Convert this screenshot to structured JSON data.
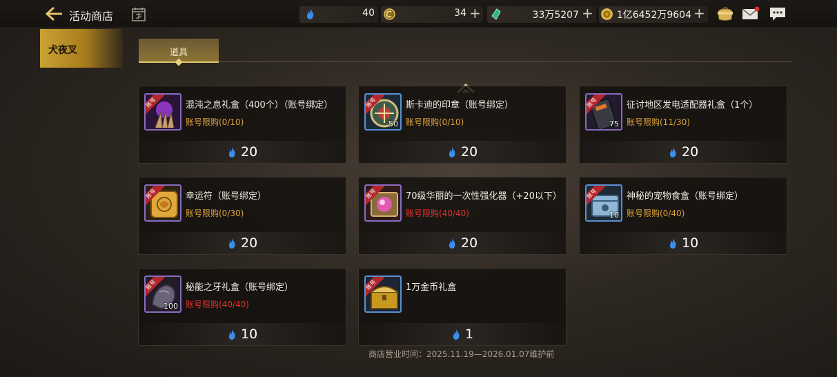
{
  "header": {
    "title": "活动商店",
    "back_icon": "back-arrow-icon",
    "calendar_icon": "calendar-icon"
  },
  "currencies": [
    {
      "icon": "blue-flame-icon",
      "value": "40",
      "has_plus": false
    },
    {
      "icon": "gold-coin-c-icon",
      "value": "34",
      "has_plus": true
    },
    {
      "icon": "green-crystal-icon",
      "value": "33万5207",
      "has_plus": true
    },
    {
      "icon": "gold-coin-icon",
      "value": "1亿6452万9604",
      "has_plus": true
    }
  ],
  "top_icons": [
    "bag-icon",
    "mail-icon",
    "chat-icon"
  ],
  "sidebar": {
    "selected_tab": "犬夜叉"
  },
  "subtabs": [
    {
      "label": "道具",
      "active": true
    }
  ],
  "items": [
    {
      "name": "混沌之息礼盒（400个）（账号绑定）",
      "limit": "账号限购(0/10)",
      "maxed": false,
      "price": "20",
      "qty": "",
      "bound": true,
      "icon": "chaos-claw-icon",
      "frame": "purple"
    },
    {
      "name": "斯卡迪的印章（账号绑定）",
      "limit": "账号限购(0/10)",
      "maxed": false,
      "price": "20",
      "qty": "50",
      "bound": true,
      "icon": "seal-medallion-icon",
      "frame": "blue"
    },
    {
      "name": "征讨地区发电适配器礼盒（1个）",
      "limit": "账号限购(11/30)",
      "maxed": false,
      "price": "20",
      "qty": "75",
      "bound": true,
      "icon": "power-adapter-icon",
      "frame": "purple"
    },
    {
      "name": "幸运符（账号绑定）",
      "limit": "账号限购(0/30)",
      "maxed": false,
      "price": "20",
      "qty": "",
      "bound": true,
      "icon": "lucky-charm-icon",
      "frame": "purple"
    },
    {
      "name": "70级华丽的一次性强化器（+20以下）",
      "limit": "账号限购(40/40)",
      "maxed": true,
      "price": "20",
      "qty": "",
      "bound": true,
      "icon": "enhancer-orb-icon",
      "frame": "purple"
    },
    {
      "name": "神秘的宠物食盒（账号绑定）",
      "limit": "账号限购(0/40)",
      "maxed": false,
      "price": "10",
      "qty": "10",
      "bound": true,
      "icon": "pet-food-box-icon",
      "frame": "blue"
    },
    {
      "name": "秘能之牙礼盒（账号绑定）",
      "limit": "账号限购(40/40)",
      "maxed": true,
      "price": "10",
      "qty": "100",
      "bound": true,
      "icon": "fang-stone-icon",
      "frame": "purple"
    },
    {
      "name": "1万金币礼盒",
      "limit": "",
      "maxed": false,
      "price": "1",
      "qty": "",
      "bound": true,
      "icon": "gold-chest-icon",
      "frame": "blue"
    }
  ],
  "bound_ribbon": "账号",
  "footer": {
    "hours": "商店营业时间：2025.11.19—2026.01.07维护前"
  },
  "colors": {
    "accent_gold": "#c9a233",
    "limit_orange": "#e0a33a",
    "limit_red": "#e0322c",
    "flame_blue": "#3a8ef0"
  }
}
